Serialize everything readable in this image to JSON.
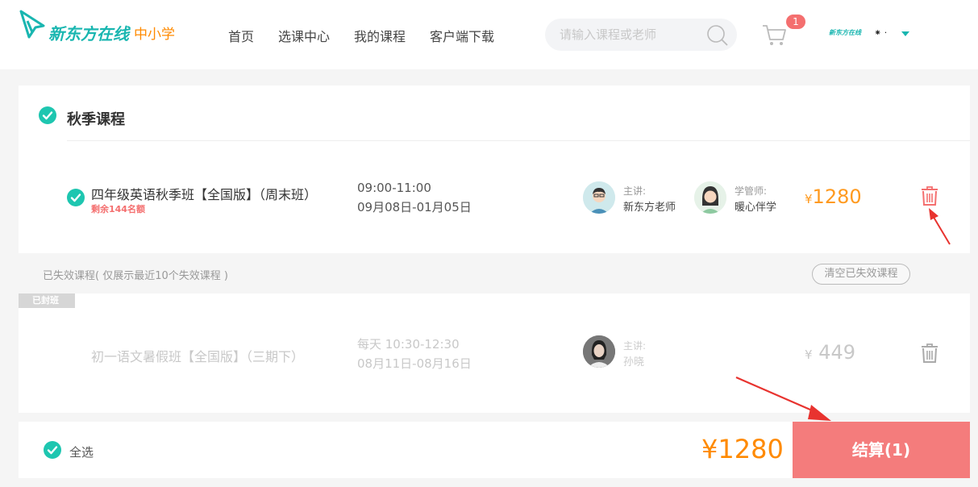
{
  "header": {
    "logo_text": "新东方在线",
    "logo_sub": "中小学",
    "nav": [
      "首页",
      "选课中心",
      "我的课程",
      "客户端下载"
    ],
    "search_placeholder": "请输入课程或老师",
    "cart_count": "1",
    "user_logo": "新东方在线",
    "user_name": "⁕ ·"
  },
  "active_section": {
    "title": "秋季课程",
    "course": {
      "name": "四年级英语秋季班【全国版】（周末班）",
      "remaining": "剩余144名额",
      "time": "09:00-11:00",
      "dates": "09月08日-01月05日",
      "lecturer_role": "主讲:",
      "lecturer_name": "新东方老师",
      "manager_role": "学管师:",
      "manager_name": "暖心伴学",
      "currency": "¥",
      "price": "1280"
    }
  },
  "expired": {
    "label": "已失效课程( 仅展示最近10个失效课程 )",
    "clear_button": "清空已失效课程",
    "badge": "已封班",
    "course": {
      "name": "初一语文暑假班【全国版】（三期下）",
      "time": "每天 10:30-12:30",
      "dates": "08月11日-08月16日",
      "lecturer_role": "主讲:",
      "lecturer_name": "孙晓",
      "currency": "¥",
      "price": "449"
    }
  },
  "footer": {
    "select_all": "全选",
    "total": "¥1280",
    "checkout": "结算(1)"
  },
  "colors": {
    "brand": "#19b6b0",
    "check": "#1ec6b0",
    "price": "#ff9a1f",
    "checkout": "#f47c7c",
    "delete": "#f46f6f"
  }
}
